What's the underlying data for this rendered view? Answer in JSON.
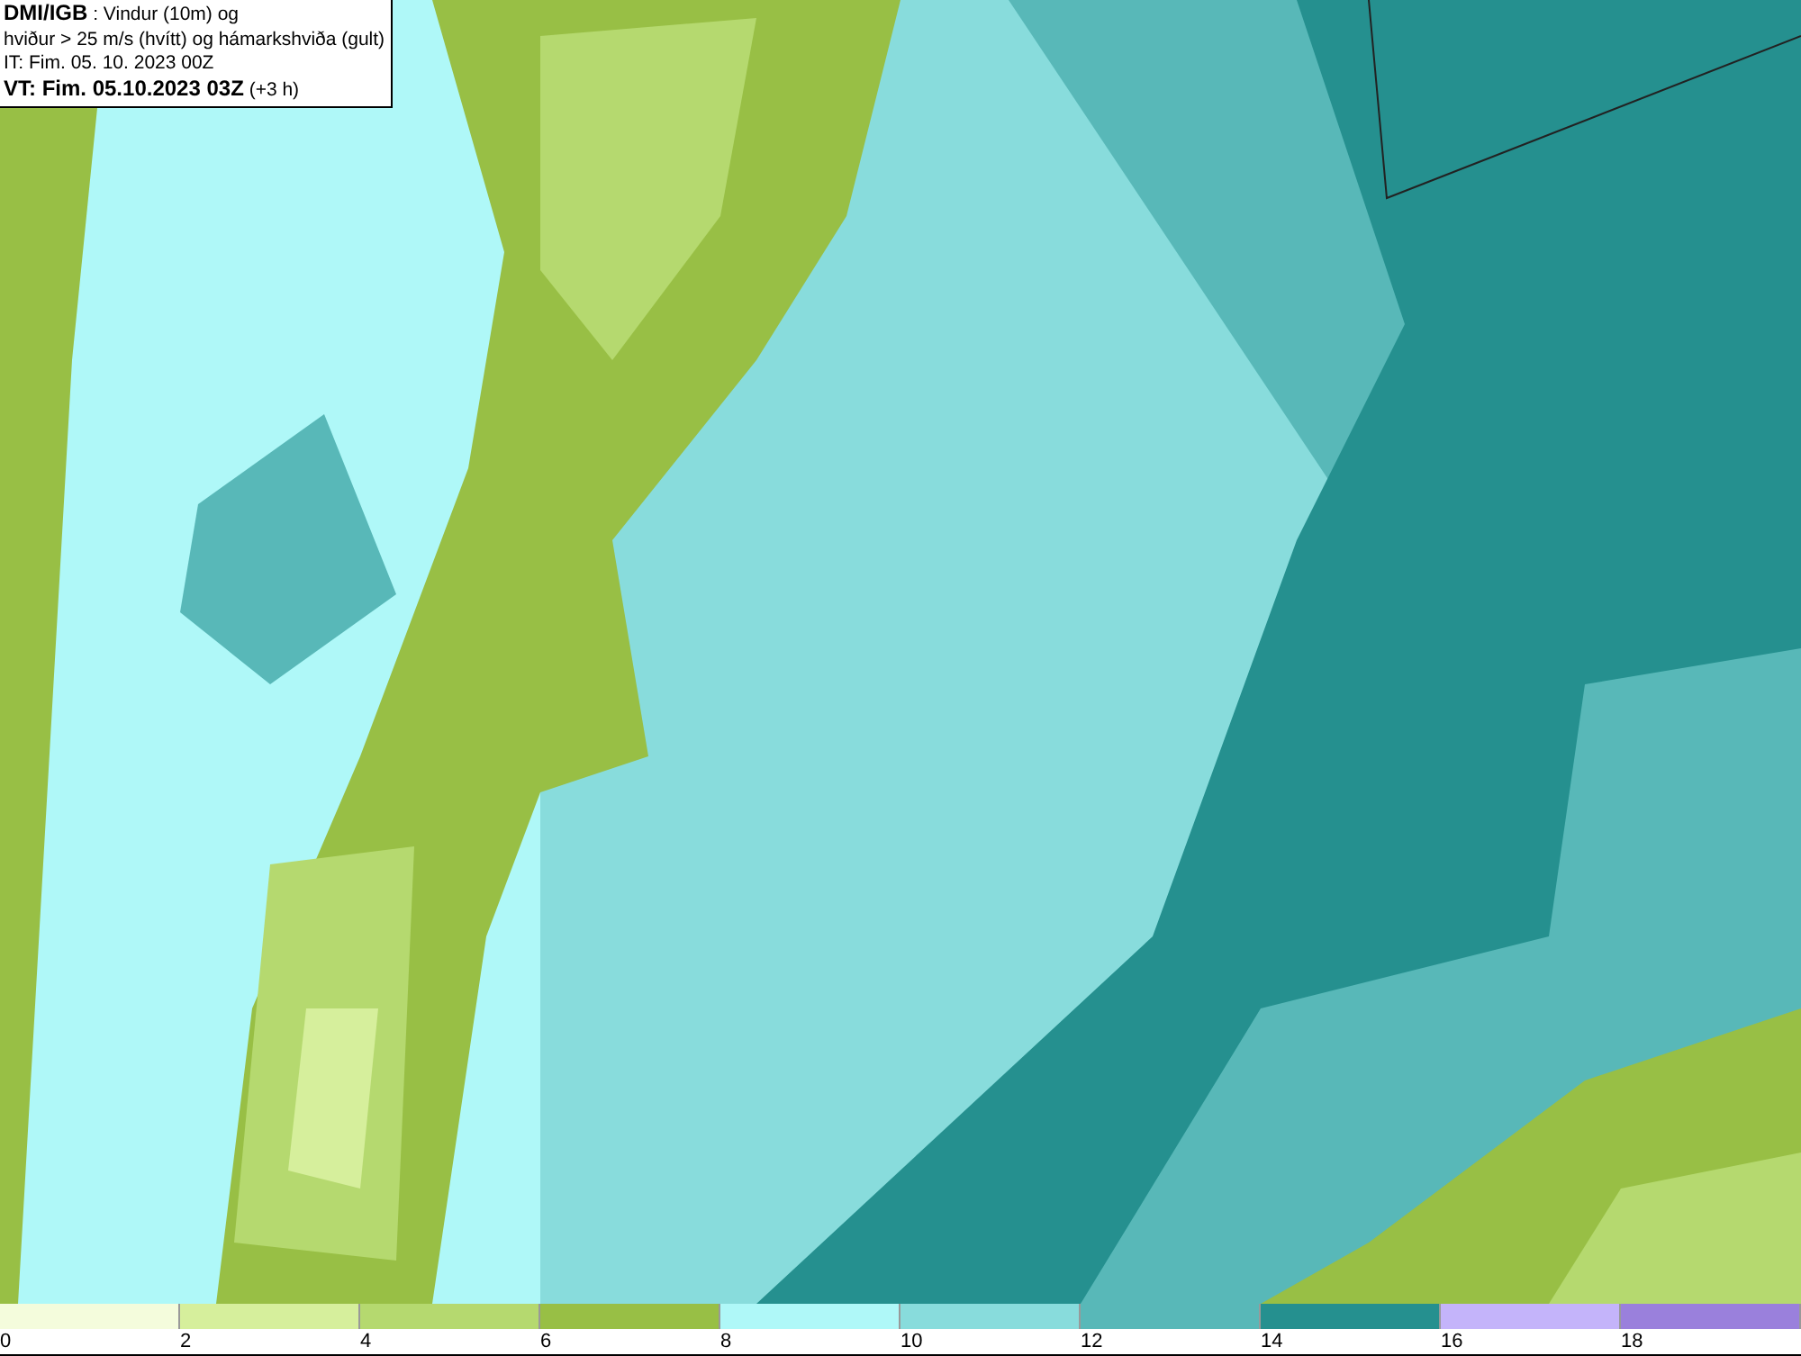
{
  "title_box": {
    "lines": [
      "**DMI/IGB** : Vindur (10m) og",
      "hviður > 25 m/s (hvítt) og hámarkshviða (gult)",
      "IT: Fim. 05. 10. 2023 00Z",
      "**VT: Fim. 05.10.2023 03Z** (+3 h)"
    ]
  },
  "legend": [
    {
      "label": "0",
      "color": "#f4fcdc"
    },
    {
      "label": "2",
      "color": "#d6ef9c"
    },
    {
      "label": "4",
      "color": "#b5d96f"
    },
    {
      "label": "6",
      "color": "#98bf45"
    },
    {
      "label": "8",
      "color": "#aff8f8"
    },
    {
      "label": "10",
      "color": "#88dcdc"
    },
    {
      "label": "12",
      "color": "#58b8b8"
    },
    {
      "label": "14",
      "color": "#25908f"
    },
    {
      "label": "16",
      "color": "#c4b4fa"
    },
    {
      "label": "18",
      "color": "#9a80dc"
    }
  ]
}
